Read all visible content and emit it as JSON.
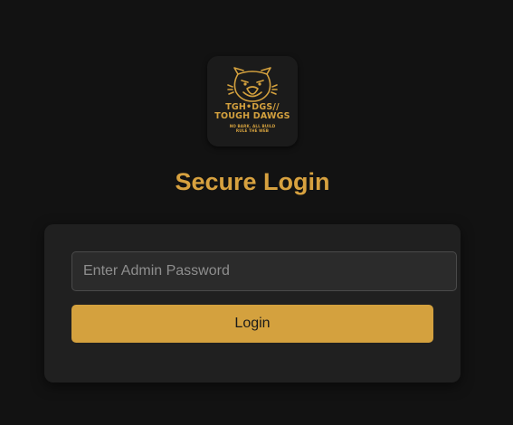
{
  "logo": {
    "icon": "bulldog-head-icon",
    "line1": "TGH•DGS//",
    "line2": "TOUGH DAWGS",
    "tagline1": "NO BARK. ALL BUILD",
    "tagline2": "RULE THE WEB"
  },
  "page": {
    "title": "Secure Login"
  },
  "form": {
    "password_placeholder": "Enter Admin Password",
    "password_value": "",
    "login_label": "Login"
  },
  "colors": {
    "background": "#121212",
    "card": "#202020",
    "accent": "#d4a13e",
    "input_bg": "#2b2b2b"
  }
}
